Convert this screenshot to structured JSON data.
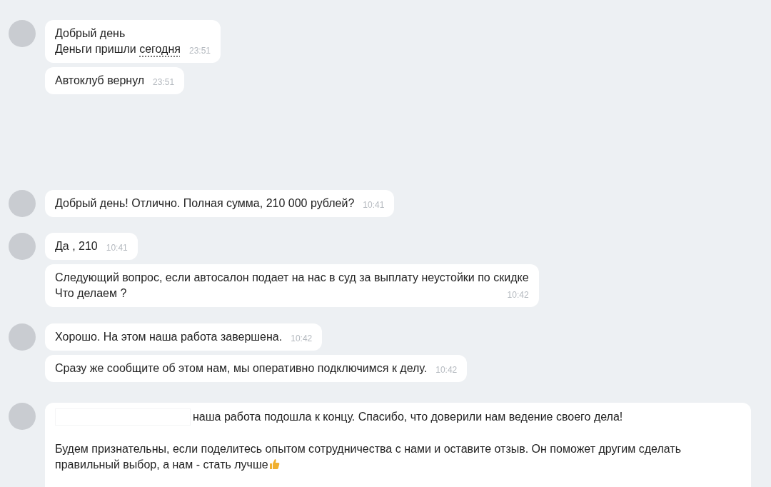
{
  "groups": [
    {
      "messages": [
        {
          "lines": [
            [
              {
                "text": "Добрый день",
                "kind": "text"
              }
            ],
            [
              {
                "text": "Деньги пришли ",
                "kind": "text"
              },
              {
                "text": "сегодня",
                "kind": "link"
              }
            ]
          ],
          "time": "23:51"
        },
        {
          "lines": [
            [
              {
                "text": "Автоклуб вернул",
                "kind": "text"
              }
            ]
          ],
          "time": "23:51"
        }
      ]
    },
    {
      "messages": [
        {
          "lines": [
            [
              {
                "text": "Добрый день! Отлично. Полная сумма, 210 000 рублей?",
                "kind": "text"
              }
            ]
          ],
          "time": "10:41"
        }
      ]
    },
    {
      "messages": [
        {
          "lines": [
            [
              {
                "text": "Да , 210",
                "kind": "text"
              }
            ]
          ],
          "time": "10:41"
        },
        {
          "lines": [
            [
              {
                "text": "Следующий вопрос, если автосалон подает на нас в суд за выплату неустойки по скидке",
                "kind": "text"
              }
            ],
            [
              {
                "text": "Что делаем ?",
                "kind": "text"
              }
            ]
          ],
          "time": "10:42"
        }
      ]
    },
    {
      "messages": [
        {
          "lines": [
            [
              {
                "text": "Хорошо. На этом наша работа завершена.",
                "kind": "text"
              }
            ]
          ],
          "time": "10:42"
        },
        {
          "lines": [
            [
              {
                "text": "Сразу же сообщите об этом нам, мы оперативно подключимся к делу.",
                "kind": "text"
              }
            ]
          ],
          "time": "10:42"
        }
      ]
    },
    {
      "messages": [
        {
          "paragraphs": [
            "наша работа подошла к концу. Спасибо, что доверили нам ведение своего дела!",
            "Будем признательны, если поделитесь опытом сотрудничества с нами и оставите отзыв. Он поможет другим сделать правильный выбор, а нам - стать лучше"
          ]
        }
      ]
    }
  ]
}
